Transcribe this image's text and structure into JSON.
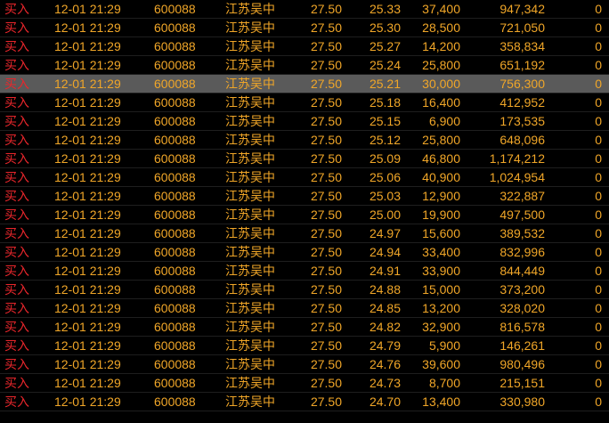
{
  "trades": [
    {
      "dir": "买入",
      "time": "12-01 21:29",
      "code": "600088",
      "name": "江苏吴中",
      "price": "27.50",
      "cost": "25.33",
      "qty": "37,400",
      "amount": "947,342",
      "flag": "0"
    },
    {
      "dir": "买入",
      "time": "12-01 21:29",
      "code": "600088",
      "name": "江苏吴中",
      "price": "27.50",
      "cost": "25.30",
      "qty": "28,500",
      "amount": "721,050",
      "flag": "0"
    },
    {
      "dir": "买入",
      "time": "12-01 21:29",
      "code": "600088",
      "name": "江苏吴中",
      "price": "27.50",
      "cost": "25.27",
      "qty": "14,200",
      "amount": "358,834",
      "flag": "0"
    },
    {
      "dir": "买入",
      "time": "12-01 21:29",
      "code": "600088",
      "name": "江苏吴中",
      "price": "27.50",
      "cost": "25.24",
      "qty": "25,800",
      "amount": "651,192",
      "flag": "0"
    },
    {
      "dir": "买入",
      "time": "12-01 21:29",
      "code": "600088",
      "name": "江苏吴中",
      "price": "27.50",
      "cost": "25.21",
      "qty": "30,000",
      "amount": "756,300",
      "flag": "0"
    },
    {
      "dir": "买入",
      "time": "12-01 21:29",
      "code": "600088",
      "name": "江苏吴中",
      "price": "27.50",
      "cost": "25.18",
      "qty": "16,400",
      "amount": "412,952",
      "flag": "0"
    },
    {
      "dir": "买入",
      "time": "12-01 21:29",
      "code": "600088",
      "name": "江苏吴中",
      "price": "27.50",
      "cost": "25.15",
      "qty": "6,900",
      "amount": "173,535",
      "flag": "0"
    },
    {
      "dir": "买入",
      "time": "12-01 21:29",
      "code": "600088",
      "name": "江苏吴中",
      "price": "27.50",
      "cost": "25.12",
      "qty": "25,800",
      "amount": "648,096",
      "flag": "0"
    },
    {
      "dir": "买入",
      "time": "12-01 21:29",
      "code": "600088",
      "name": "江苏吴中",
      "price": "27.50",
      "cost": "25.09",
      "qty": "46,800",
      "amount": "1,174,212",
      "flag": "0"
    },
    {
      "dir": "买入",
      "time": "12-01 21:29",
      "code": "600088",
      "name": "江苏吴中",
      "price": "27.50",
      "cost": "25.06",
      "qty": "40,900",
      "amount": "1,024,954",
      "flag": "0"
    },
    {
      "dir": "买入",
      "time": "12-01 21:29",
      "code": "600088",
      "name": "江苏吴中",
      "price": "27.50",
      "cost": "25.03",
      "qty": "12,900",
      "amount": "322,887",
      "flag": "0"
    },
    {
      "dir": "买入",
      "time": "12-01 21:29",
      "code": "600088",
      "name": "江苏吴中",
      "price": "27.50",
      "cost": "25.00",
      "qty": "19,900",
      "amount": "497,500",
      "flag": "0"
    },
    {
      "dir": "买入",
      "time": "12-01 21:29",
      "code": "600088",
      "name": "江苏吴中",
      "price": "27.50",
      "cost": "24.97",
      "qty": "15,600",
      "amount": "389,532",
      "flag": "0"
    },
    {
      "dir": "买入",
      "time": "12-01 21:29",
      "code": "600088",
      "name": "江苏吴中",
      "price": "27.50",
      "cost": "24.94",
      "qty": "33,400",
      "amount": "832,996",
      "flag": "0"
    },
    {
      "dir": "买入",
      "time": "12-01 21:29",
      "code": "600088",
      "name": "江苏吴中",
      "price": "27.50",
      "cost": "24.91",
      "qty": "33,900",
      "amount": "844,449",
      "flag": "0"
    },
    {
      "dir": "买入",
      "time": "12-01 21:29",
      "code": "600088",
      "name": "江苏吴中",
      "price": "27.50",
      "cost": "24.88",
      "qty": "15,000",
      "amount": "373,200",
      "flag": "0"
    },
    {
      "dir": "买入",
      "time": "12-01 21:29",
      "code": "600088",
      "name": "江苏吴中",
      "price": "27.50",
      "cost": "24.85",
      "qty": "13,200",
      "amount": "328,020",
      "flag": "0"
    },
    {
      "dir": "买入",
      "time": "12-01 21:29",
      "code": "600088",
      "name": "江苏吴中",
      "price": "27.50",
      "cost": "24.82",
      "qty": "32,900",
      "amount": "816,578",
      "flag": "0"
    },
    {
      "dir": "买入",
      "time": "12-01 21:29",
      "code": "600088",
      "name": "江苏吴中",
      "price": "27.50",
      "cost": "24.79",
      "qty": "5,900",
      "amount": "146,261",
      "flag": "0"
    },
    {
      "dir": "买入",
      "time": "12-01 21:29",
      "code": "600088",
      "name": "江苏吴中",
      "price": "27.50",
      "cost": "24.76",
      "qty": "39,600",
      "amount": "980,496",
      "flag": "0"
    },
    {
      "dir": "买入",
      "time": "12-01 21:29",
      "code": "600088",
      "name": "江苏吴中",
      "price": "27.50",
      "cost": "24.73",
      "qty": "8,700",
      "amount": "215,151",
      "flag": "0"
    },
    {
      "dir": "买入",
      "time": "12-01 21:29",
      "code": "600088",
      "name": "江苏吴中",
      "price": "27.50",
      "cost": "24.70",
      "qty": "13,400",
      "amount": "330,980",
      "flag": "0"
    }
  ],
  "selected_row": 4,
  "colors": {
    "background": "#000000",
    "text": "#f0a628",
    "buy": "#e8262b",
    "selected_bg": "#5a5a5a"
  }
}
